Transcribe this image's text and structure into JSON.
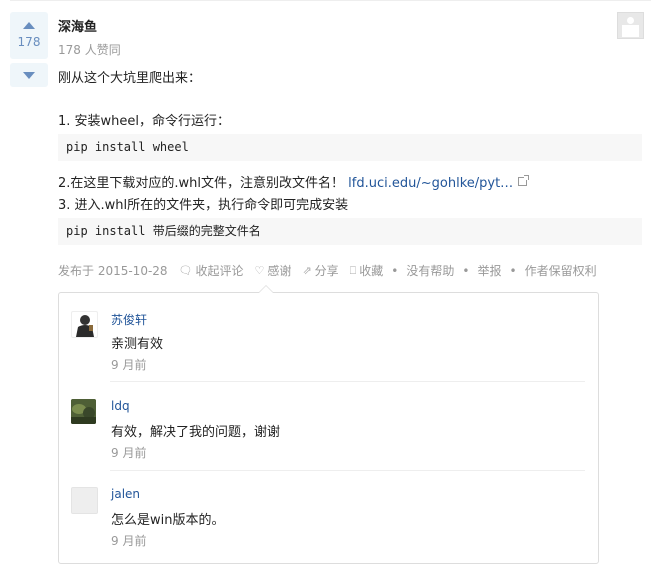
{
  "answer": {
    "votes": "178",
    "author": "深海鱼",
    "agree_text": "178 人赞同",
    "intro": "刚从这个大坑里爬出来：",
    "step1": "1. 安装wheel，命令行运行：",
    "code1": "pip install wheel",
    "step2_prefix": "2.在这里下载对应的.whl文件，注意别改文件名！",
    "step2_link": "lfd.uci.edu/~gohlke/pyt…",
    "step3": "3. 进入.whl所在的文件夹，执行命令即可完成安装",
    "code2": "pip install 带后缀的完整文件名"
  },
  "meta": {
    "published": "发布于 2015-10-28",
    "fold_comments": "收起评论",
    "thanks": "感谢",
    "share": "分享",
    "collect": "收藏",
    "no_help": "没有帮助",
    "report": "举报",
    "copyright": "作者保留权利",
    "dot": "•"
  },
  "comments": [
    {
      "name": "苏俊轩",
      "text": "亲测有效",
      "time": "9 月前"
    },
    {
      "name": "ldq",
      "text": "有效，解决了我的问题，谢谢",
      "time": "9 月前"
    },
    {
      "name": "jalen",
      "text": "怎么是win版本的。",
      "time": "9 月前"
    }
  ],
  "icons": {
    "comment": "comment-icon",
    "thanks": "heart-icon",
    "share": "share-icon",
    "collect": "bookmark-icon"
  }
}
